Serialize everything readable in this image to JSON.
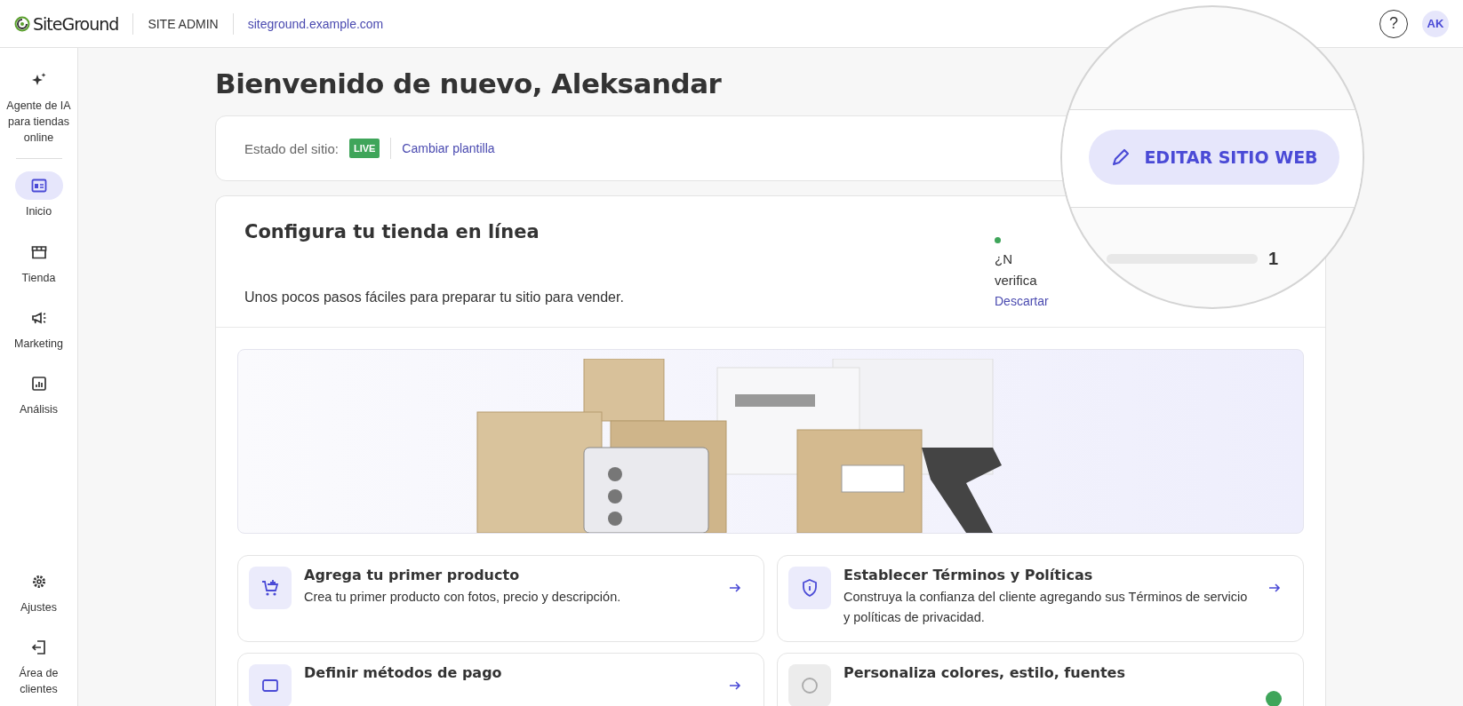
{
  "topbar": {
    "logo": "SiteGround",
    "section": "SITE ADMIN",
    "domain": "siteground.example.com",
    "help": "?",
    "avatar": "AK"
  },
  "sidebar": {
    "items": [
      {
        "label": "Agente de IA para tiendas online",
        "selected": false
      },
      {
        "label": "Inicio",
        "selected": true
      },
      {
        "label": "Tienda",
        "selected": false
      },
      {
        "label": "Marketing",
        "selected": false
      },
      {
        "label": "Análisis",
        "selected": false
      }
    ],
    "bottom_items": [
      {
        "label": "Ajustes",
        "selected": false
      },
      {
        "label": "Área de clientes",
        "selected": false
      }
    ]
  },
  "greeting": "Bienvenido de nuevo, Aleksandar",
  "status_card": {
    "label": "Estado del sitio:",
    "badge": "LIVE",
    "link": "Cambiar plantilla"
  },
  "magnifier": {
    "button": "EDITAR SITIO WEB",
    "progress": {
      "level": 0,
      "reading": "1"
    }
  },
  "setup": {
    "title": "Configura tu tienda en línea",
    "subtitle": "Unos pocos pasos fáciles para preparar tu sitio para vender.",
    "notice_lines": [
      "¿N",
      "verifica"
    ],
    "dismiss": "Descartar",
    "tasks": [
      {
        "title": "Agrega tu primer producto",
        "description": "Crea tu primer producto con fotos, precio y descripción.",
        "completed": false
      },
      {
        "title": "Establecer Términos y Políticas",
        "description": "Construya la confianza del cliente agregando sus Términos de servicio y políticas de privacidad.",
        "completed": false
      },
      {
        "title": "Definir métodos de pago",
        "completed": false
      },
      {
        "title": "Personaliza colores, estilo, fuentes",
        "completed": true
      }
    ]
  }
}
